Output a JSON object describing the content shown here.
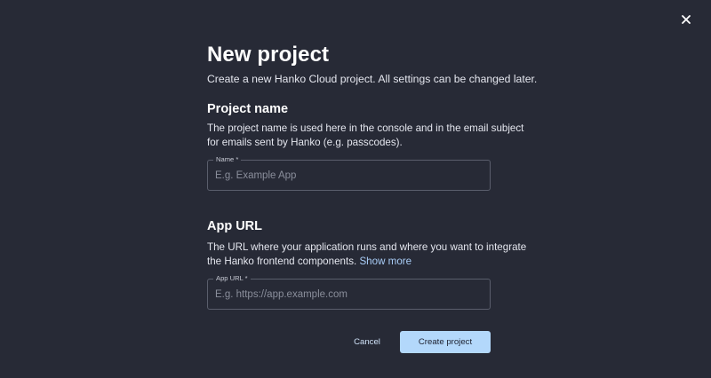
{
  "dialog": {
    "title": "New project",
    "subtitle": "Create a new Hanko Cloud project. All settings can be changed later.",
    "close_icon": "close-icon"
  },
  "project_name": {
    "heading": "Project name",
    "description_line1": "The project name is used here in the console and in the email subject",
    "description_line2": "for emails sent by Hanko (e.g. passcodes).",
    "field_label": "Name *",
    "field_value": "",
    "field_placeholder": "E.g. Example App"
  },
  "app_url": {
    "heading": "App URL",
    "description_line1": "The URL where your application runs and where you want to integrate",
    "description_line2": "the Hanko frontend components.",
    "show_more_link": "Show more",
    "field_label": "App URL *",
    "field_value": "",
    "field_placeholder": "E.g. https://app.example.com"
  },
  "actions": {
    "cancel_label": "Cancel",
    "create_label": "Create project"
  },
  "colors": {
    "background": "#272a36",
    "primary_button": "#b3d8fb",
    "link": "#a9cdf7",
    "border": "#5a5e6c"
  }
}
